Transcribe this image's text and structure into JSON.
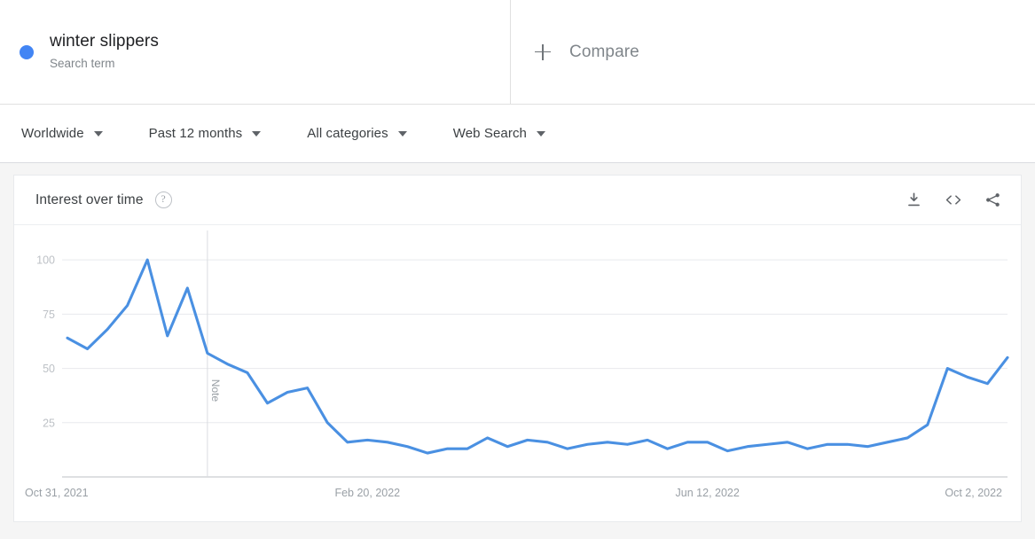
{
  "term": {
    "title": "winter slippers",
    "subtitle": "Search term",
    "dot_color": "#4285f4"
  },
  "compare": {
    "label": "Compare",
    "icon": "plus-icon"
  },
  "filters": [
    {
      "label": "Worldwide",
      "icon": "chevron-down-icon"
    },
    {
      "label": "Past 12 months",
      "icon": "chevron-down-icon"
    },
    {
      "label": "All categories",
      "icon": "chevron-down-icon"
    },
    {
      "label": "Web Search",
      "icon": "chevron-down-icon"
    }
  ],
  "card": {
    "title": "Interest over time",
    "help_icon": "help-icon",
    "help_glyph": "?",
    "actions": [
      {
        "name": "download-icon"
      },
      {
        "name": "embed-code-icon"
      },
      {
        "name": "share-icon"
      }
    ]
  },
  "chart_data": {
    "type": "line",
    "title": "Interest over time",
    "xlabel": "",
    "ylabel": "",
    "ylim": [
      0,
      107
    ],
    "yticks": [
      25,
      50,
      75,
      100
    ],
    "grid": true,
    "legend": "winter slippers",
    "line_color": "#4a90e2",
    "xtick_labels": [
      "Oct 31, 2021",
      "Feb 20, 2022",
      "Jun 12, 2022",
      "Oct 2, 2022"
    ],
    "xtick_positions": [
      0,
      15,
      32,
      48
    ],
    "annotation": {
      "label": "Note",
      "index": 7
    },
    "series": [
      {
        "name": "winter slippers",
        "values": [
          64,
          59,
          68,
          79,
          100,
          65,
          87,
          57,
          52,
          48,
          34,
          39,
          41,
          25,
          16,
          17,
          16,
          14,
          11,
          13,
          13,
          18,
          14,
          17,
          16,
          13,
          15,
          16,
          15,
          17,
          13,
          16,
          16,
          12,
          14,
          15,
          16,
          13,
          15,
          15,
          14,
          16,
          18,
          24,
          50,
          46,
          43,
          55
        ]
      }
    ]
  }
}
